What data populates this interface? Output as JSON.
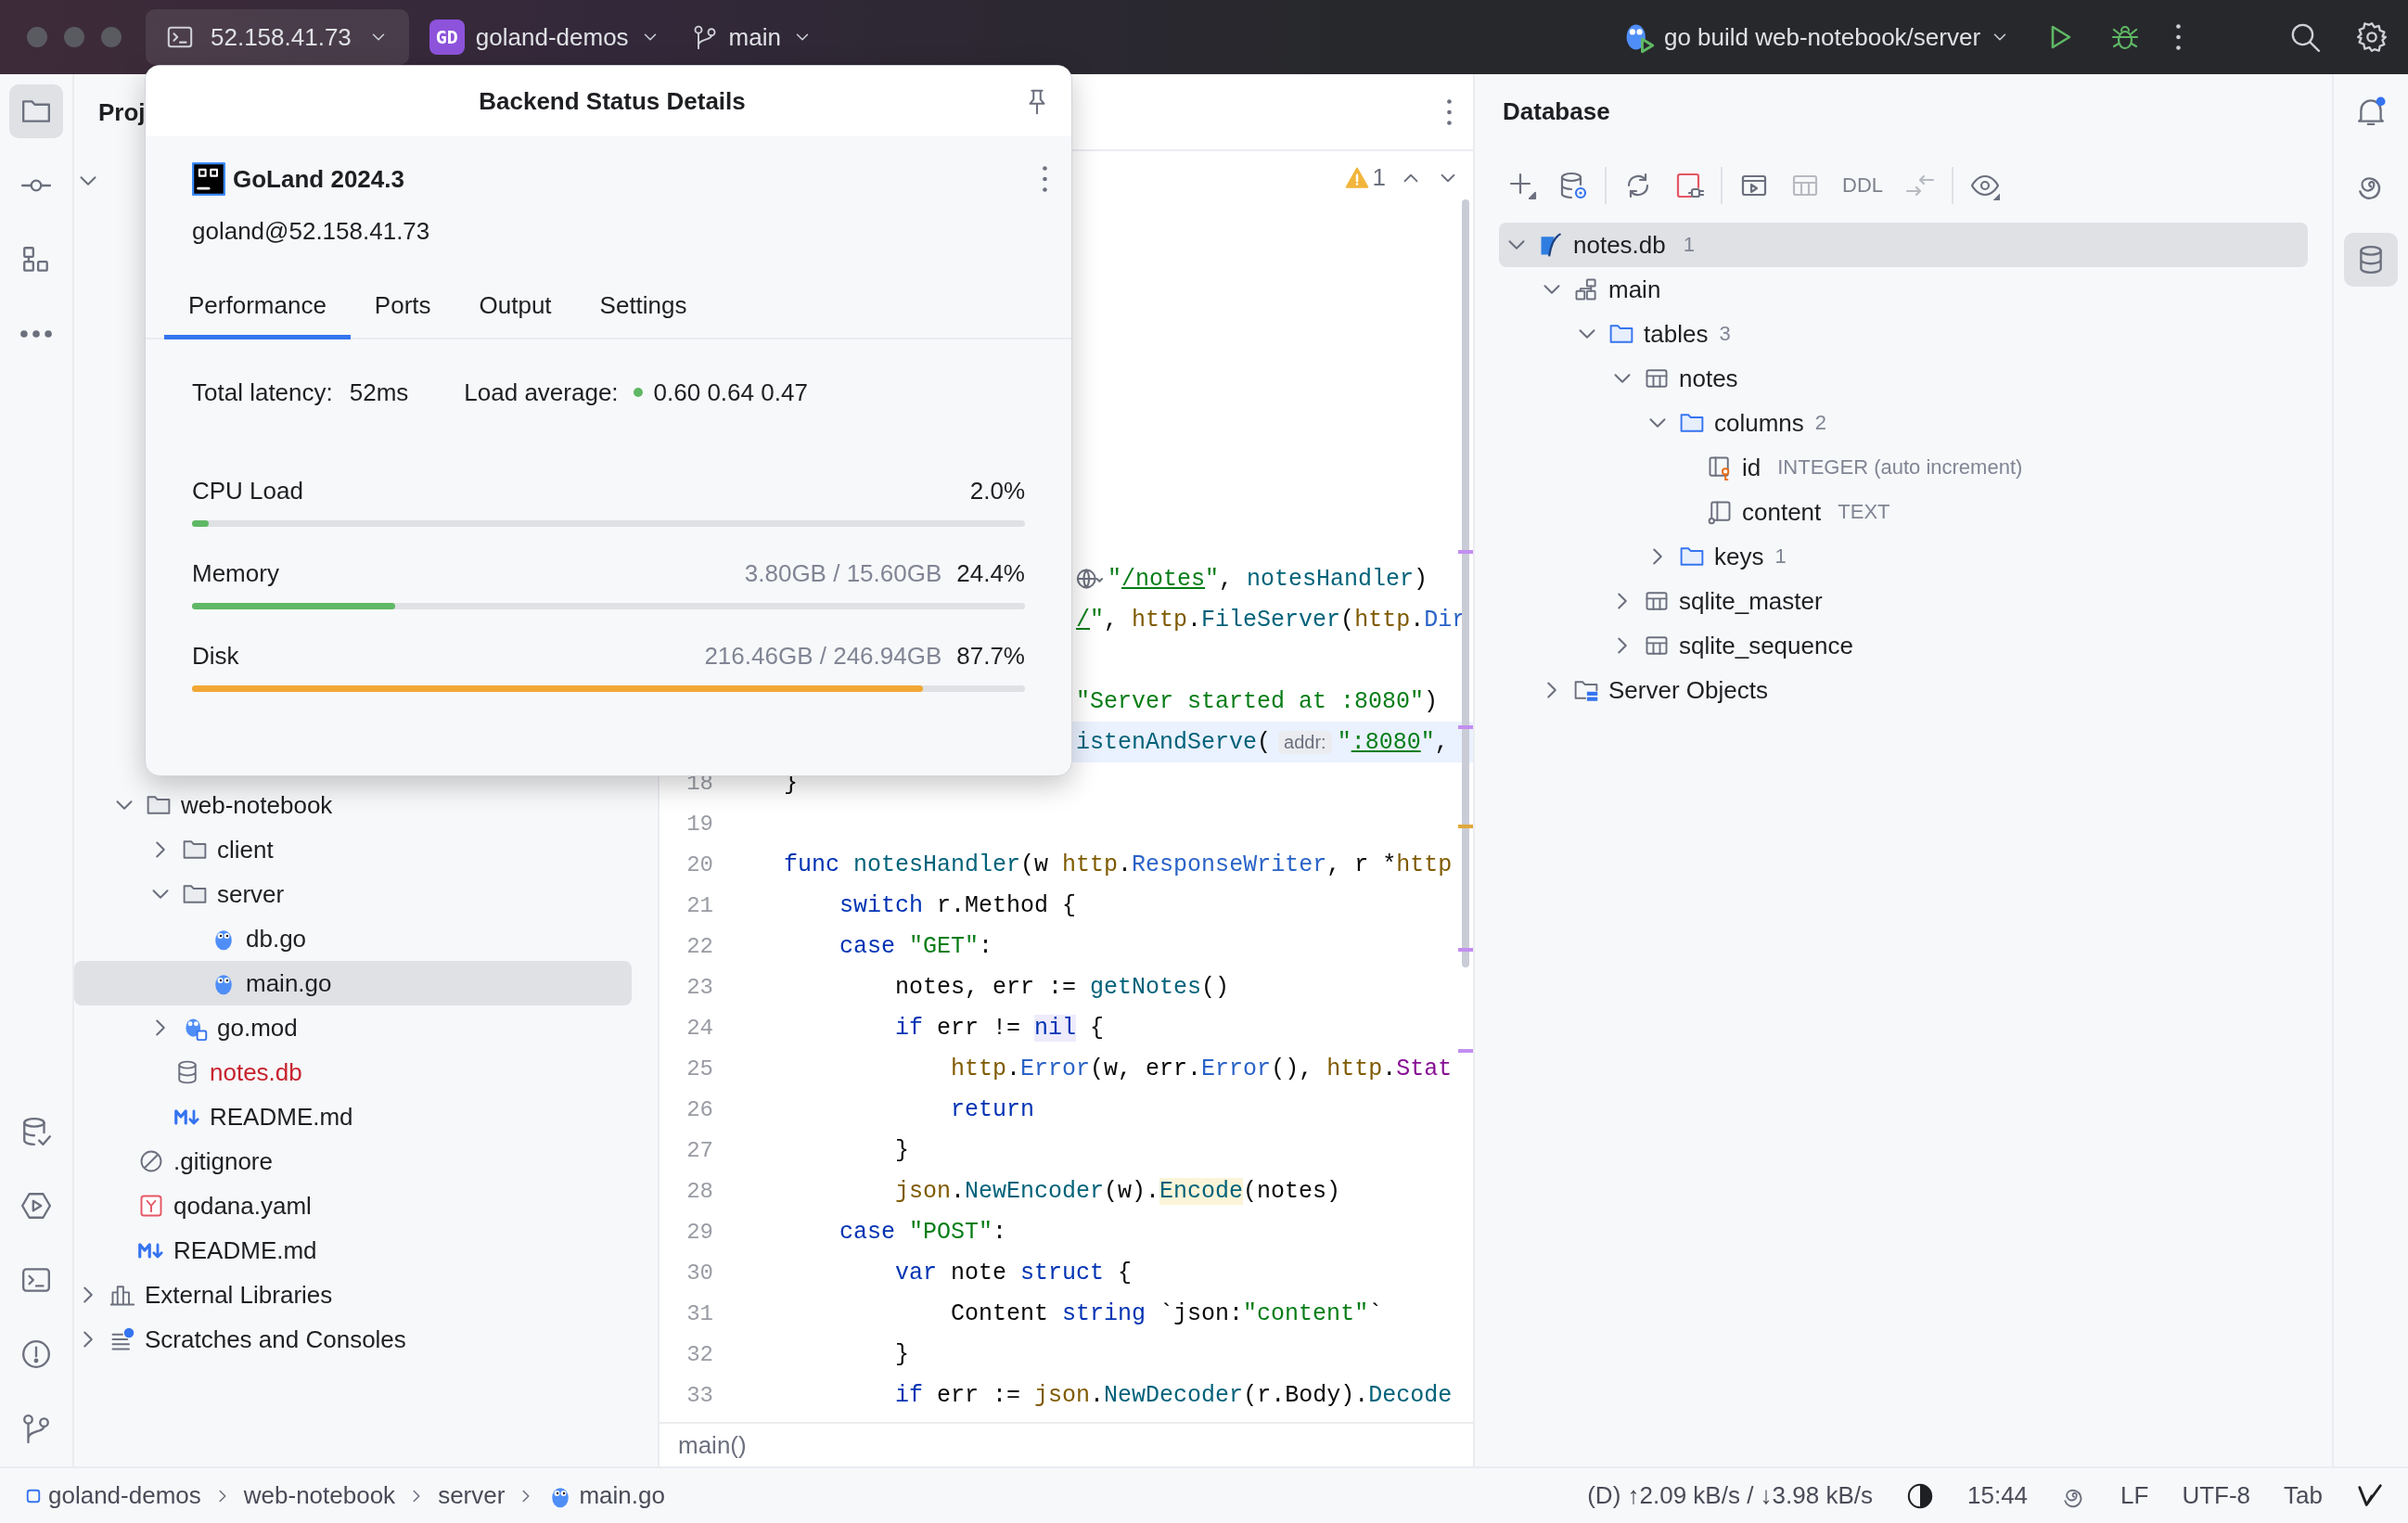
{
  "title_bar": {
    "host": "52.158.41.73",
    "project_badge": "GD",
    "project": "goland-demos",
    "branch": "main",
    "run_config": "go build web-notebook/server"
  },
  "left_stripe": {
    "top": [
      {
        "kind": "folder",
        "selected": true
      },
      {
        "kind": "commit",
        "selected": false
      },
      {
        "kind": "structure",
        "selected": false
      },
      {
        "kind": "more_h",
        "selected": false
      }
    ],
    "bottom": [
      {
        "kind": "db_check",
        "selected": false
      },
      {
        "kind": "services",
        "selected": false
      },
      {
        "kind": "terminal",
        "selected": false
      },
      {
        "kind": "problems",
        "selected": false
      },
      {
        "kind": "git",
        "selected": false
      }
    ]
  },
  "project": {
    "title": "Proj",
    "tree": [
      {
        "expanded": true,
        "selected": false,
        "children": [
          {
            "label": "web-notebook",
            "kind": "folder",
            "expanded": true,
            "selected": false,
            "children": [
              {
                "label": "client",
                "kind": "folder",
                "expanded": false,
                "selected": false
              },
              {
                "label": "server",
                "kind": "folder",
                "expanded": true,
                "selected": false,
                "children": [
                  {
                    "label": "db.go",
                    "kind": "gopher",
                    "selected": false
                  },
                  {
                    "label": "main.go",
                    "kind": "gopher",
                    "selected": true
                  }
                ]
              },
              {
                "label": "go.mod",
                "kind": "gomod",
                "expanded": false,
                "selected": false
              },
              {
                "label": "notes.db",
                "kind": "dbfile",
                "selected": false,
                "unversioned": true
              },
              {
                "label": "README.md",
                "kind": "markdown",
                "selected": false
              }
            ]
          },
          {
            "label": ".gitignore",
            "kind": "gitignore",
            "selected": false
          },
          {
            "label": "qodana.yaml",
            "kind": "yaml",
            "selected": false
          },
          {
            "label": "README.md",
            "kind": "markdown",
            "selected": false
          }
        ]
      },
      {
        "label": "External Libraries",
        "kind": "libraries",
        "expanded": false,
        "selected": false
      },
      {
        "label": "Scratches and Consoles",
        "kind": "scratches",
        "expanded": false,
        "selected": false
      }
    ]
  },
  "editor": {
    "warnings": "1",
    "breadcrumb": "main()",
    "lines": [
      {
        "kind": "covered",
        "current": false,
        "tokens": [
          {
            "kind": "globe"
          },
          {
            "kind": "string",
            "text": "\""
          },
          {
            "kind": "link",
            "text": "/notes"
          },
          {
            "kind": "string",
            "text": "\""
          },
          {
            "kind": "plain",
            "text": ","
          },
          {
            "kind": "func",
            "text": " notesHandler"
          },
          {
            "kind": "plain",
            "text": ")"
          }
        ]
      },
      {
        "kind": "covered",
        "current": false,
        "tokens": [
          {
            "kind": "link",
            "text": "/"
          },
          {
            "kind": "string",
            "text": "\""
          },
          {
            "kind": "plain",
            "text": ","
          },
          {
            "kind": "package",
            "text": " http"
          },
          {
            "kind": "plain",
            "text": "."
          },
          {
            "kind": "func",
            "text": "FileServer"
          },
          {
            "kind": "plain",
            "text": "("
          },
          {
            "kind": "package",
            "text": "http"
          },
          {
            "kind": "plain",
            "text": "."
          },
          {
            "kind": "type",
            "text": "Dir"
          }
        ]
      },
      {
        "kind": "covered",
        "current": false
      },
      {
        "kind": "covered",
        "current": false,
        "tokens": [
          {
            "kind": "string",
            "text": "\"Server started at :8080\""
          },
          {
            "kind": "plain",
            "text": ")"
          }
        ]
      },
      {
        "kind": "covered",
        "current": true,
        "tokens": [
          {
            "kind": "func",
            "text": "istenAndServe"
          },
          {
            "kind": "plain",
            "text": "("
          },
          {
            "kind": "hint",
            "text": "addr:"
          },
          {
            "kind": "string",
            "text": "\""
          },
          {
            "kind": "link",
            "text": ":8080"
          },
          {
            "kind": "string",
            "text": "\""
          },
          {
            "kind": "plain",
            "text": ","
          }
        ]
      },
      {
        "kind": "numbered",
        "number": "18",
        "current": false,
        "tokens": [
          {
            "kind": "plain",
            "text": "}"
          }
        ]
      },
      {
        "kind": "numbered",
        "number": "19",
        "current": false
      },
      {
        "kind": "numbered",
        "number": "20",
        "current": false,
        "tokens": [
          {
            "kind": "keyword",
            "text": "func"
          },
          {
            "kind": "func",
            "text": " notesHandler"
          },
          {
            "kind": "plain",
            "text": "(w"
          },
          {
            "kind": "package",
            "text": " http"
          },
          {
            "kind": "plain",
            "text": "."
          },
          {
            "kind": "type",
            "text": "ResponseWriter"
          },
          {
            "kind": "plain",
            "text": ", r *"
          },
          {
            "kind": "package",
            "text": "http"
          }
        ]
      },
      {
        "kind": "numbered",
        "number": "21",
        "current": false,
        "tokens": [
          {
            "kind": "keyword",
            "text": "    switch"
          },
          {
            "kind": "plain",
            "text": " r.Method {"
          }
        ]
      },
      {
        "kind": "numbered",
        "number": "22",
        "current": false,
        "tokens": [
          {
            "kind": "keyword",
            "text": "    case"
          },
          {
            "kind": "string",
            "text": " \"GET\""
          },
          {
            "kind": "plain",
            "text": ":"
          }
        ]
      },
      {
        "kind": "numbered",
        "number": "23",
        "current": false,
        "tokens": [
          {
            "kind": "plain",
            "text": "        notes, err := "
          },
          {
            "kind": "func",
            "text": "getNotes"
          },
          {
            "kind": "plain",
            "text": "()"
          }
        ]
      },
      {
        "kind": "numbered",
        "number": "24",
        "current": false,
        "tokens": [
          {
            "kind": "keyword",
            "text": "        if"
          },
          {
            "kind": "plain",
            "text": " err != "
          },
          {
            "kind": "keyword",
            "text": "nil",
            "highlight": true
          },
          {
            "kind": "plain",
            "text": " {"
          }
        ]
      },
      {
        "kind": "numbered",
        "number": "25",
        "current": false,
        "tokens": [
          {
            "kind": "package",
            "text": "            http"
          },
          {
            "kind": "plain",
            "text": "."
          },
          {
            "kind": "type",
            "text": "Error"
          },
          {
            "kind": "plain",
            "text": "(w, err."
          },
          {
            "kind": "type",
            "text": "Error"
          },
          {
            "kind": "plain",
            "text": "(), "
          },
          {
            "kind": "package",
            "text": "http"
          },
          {
            "kind": "plain",
            "text": "."
          },
          {
            "kind": "const",
            "text": "Stat"
          }
        ]
      },
      {
        "kind": "numbered",
        "number": "26",
        "current": false,
        "tokens": [
          {
            "kind": "keyword",
            "text": "            return"
          }
        ]
      },
      {
        "kind": "numbered",
        "number": "27",
        "current": false,
        "tokens": [
          {
            "kind": "plain",
            "text": "        }"
          }
        ]
      },
      {
        "kind": "numbered",
        "number": "28",
        "current": false,
        "tokens": [
          {
            "kind": "package",
            "text": "        json"
          },
          {
            "kind": "plain",
            "text": "."
          },
          {
            "kind": "func",
            "text": "NewEncoder"
          },
          {
            "kind": "plain",
            "text": "(w)."
          },
          {
            "kind": "func",
            "text": "Encode",
            "highlight": true
          },
          {
            "kind": "plain",
            "text": "(notes)"
          }
        ]
      },
      {
        "kind": "numbered",
        "number": "29",
        "current": false,
        "tokens": [
          {
            "kind": "keyword",
            "text": "    case"
          },
          {
            "kind": "string",
            "text": " \"POST\""
          },
          {
            "kind": "plain",
            "text": ":"
          }
        ]
      },
      {
        "kind": "numbered",
        "number": "30",
        "current": false,
        "tokens": [
          {
            "kind": "keyword",
            "text": "        var"
          },
          {
            "kind": "plain",
            "text": " note "
          },
          {
            "kind": "keyword",
            "text": "struct"
          },
          {
            "kind": "plain",
            "text": " {"
          }
        ]
      },
      {
        "kind": "numbered",
        "number": "31",
        "current": false,
        "tokens": [
          {
            "kind": "plain",
            "text": "            Content "
          },
          {
            "kind": "keyword",
            "text": "string"
          },
          {
            "kind": "plain",
            "text": " `json:"
          },
          {
            "kind": "string",
            "text": "\"content\""
          },
          {
            "kind": "plain",
            "text": "`"
          }
        ]
      },
      {
        "kind": "numbered",
        "number": "32",
        "current": false,
        "tokens": [
          {
            "kind": "plain",
            "text": "        }"
          }
        ]
      },
      {
        "kind": "numbered",
        "number": "33",
        "current": false,
        "tokens": [
          {
            "kind": "keyword",
            "text": "        if"
          },
          {
            "kind": "plain",
            "text": " err := "
          },
          {
            "kind": "package",
            "text": "json"
          },
          {
            "kind": "plain",
            "text": "."
          },
          {
            "kind": "func",
            "text": "NewDecoder"
          },
          {
            "kind": "plain",
            "text": "(r.Body)."
          },
          {
            "kind": "func",
            "text": "Decode"
          }
        ]
      }
    ]
  },
  "backend_popup": {
    "title": "Backend Status Details",
    "product": "GoLand 2024.3",
    "host": "goland@52.158.41.73",
    "tabs": [
      {
        "label": "Performance",
        "selected": true
      },
      {
        "label": "Ports",
        "selected": false
      },
      {
        "label": "Output",
        "selected": false
      },
      {
        "label": "Settings",
        "selected": false
      }
    ],
    "latency": {
      "label": "Total latency:",
      "value": "52ms"
    },
    "load": {
      "label": "Load average:",
      "healthy": true,
      "value": "0.60 0.64 0.47"
    },
    "meters": [
      {
        "name": "CPU Load",
        "reading": "2.0%",
        "level": 0.02,
        "color": "#5fb865"
      },
      {
        "name": "Memory",
        "detail": "3.80GB / 15.60GB",
        "reading": "24.4%",
        "level": 0.244,
        "color": "#5fb865"
      },
      {
        "name": "Disk",
        "detail": "216.46GB / 246.94GB",
        "reading": "87.7%",
        "level": 0.877,
        "color": "#f2a735"
      }
    ]
  },
  "database": {
    "title": "Database",
    "toolbar": [
      {
        "kind": "plus",
        "disabled": false
      },
      {
        "kind": "db_settings",
        "disabled": false
      },
      {
        "kind": "separator"
      },
      {
        "kind": "refresh",
        "disabled": false
      },
      {
        "kind": "disconnect",
        "disabled": false
      },
      {
        "kind": "separator"
      },
      {
        "kind": "console",
        "disabled": false
      },
      {
        "kind": "table",
        "disabled": true
      },
      {
        "kind": "text",
        "label": "DDL",
        "disabled": true
      },
      {
        "kind": "compare",
        "disabled": true
      },
      {
        "kind": "separator"
      },
      {
        "kind": "eye",
        "disabled": false
      }
    ],
    "tree": [
      {
        "label": "notes.db",
        "kind": "sqlite",
        "count": "1",
        "expanded": true,
        "selected": true,
        "children": [
          {
            "label": "main",
            "kind": "schema",
            "expanded": true,
            "selected": false,
            "children": [
              {
                "label": "tables",
                "kind": "folder_blue",
                "count": "3",
                "expanded": true,
                "selected": false,
                "children": [
                  {
                    "label": "notes",
                    "kind": "table",
                    "expanded": true,
                    "selected": false,
                    "children": [
                      {
                        "label": "columns",
                        "kind": "folder_blue",
                        "count": "2",
                        "expanded": true,
                        "selected": false,
                        "children": [
                          {
                            "label": "id",
                            "kind": "column_key",
                            "type": "INTEGER (auto increment)",
                            "selected": false
                          },
                          {
                            "label": "content",
                            "kind": "column",
                            "type": "TEXT",
                            "selected": false
                          }
                        ]
                      },
                      {
                        "label": "keys",
                        "kind": "folder_blue",
                        "count": "1",
                        "expanded": false,
                        "selected": false
                      }
                    ]
                  },
                  {
                    "label": "sqlite_master",
                    "kind": "table",
                    "expanded": false,
                    "selected": false
                  },
                  {
                    "label": "sqlite_sequence",
                    "kind": "table",
                    "expanded": false,
                    "selected": false
                  }
                ]
              }
            ]
          },
          {
            "label": "Server Objects",
            "kind": "server_objects",
            "expanded": false,
            "selected": false
          }
        ]
      }
    ]
  },
  "right_stripe": [
    {
      "kind": "bell",
      "selected": false,
      "badge": true
    },
    {
      "kind": "spiral",
      "selected": false,
      "badge": false
    },
    {
      "kind": "database",
      "selected": true,
      "badge": false
    }
  ],
  "status_bar": {
    "breadcrumbs": [
      {
        "label": "goland-demos",
        "kind": "module"
      },
      {
        "label": "web-notebook"
      },
      {
        "label": "server"
      },
      {
        "label": "main.go",
        "kind": "gopher"
      }
    ],
    "network": "(D) ↑2.09 kB/s / ↓3.98 kB/s",
    "time": "15:44",
    "line_separator": "LF",
    "encoding": "UTF-8",
    "indent": "Tab"
  }
}
